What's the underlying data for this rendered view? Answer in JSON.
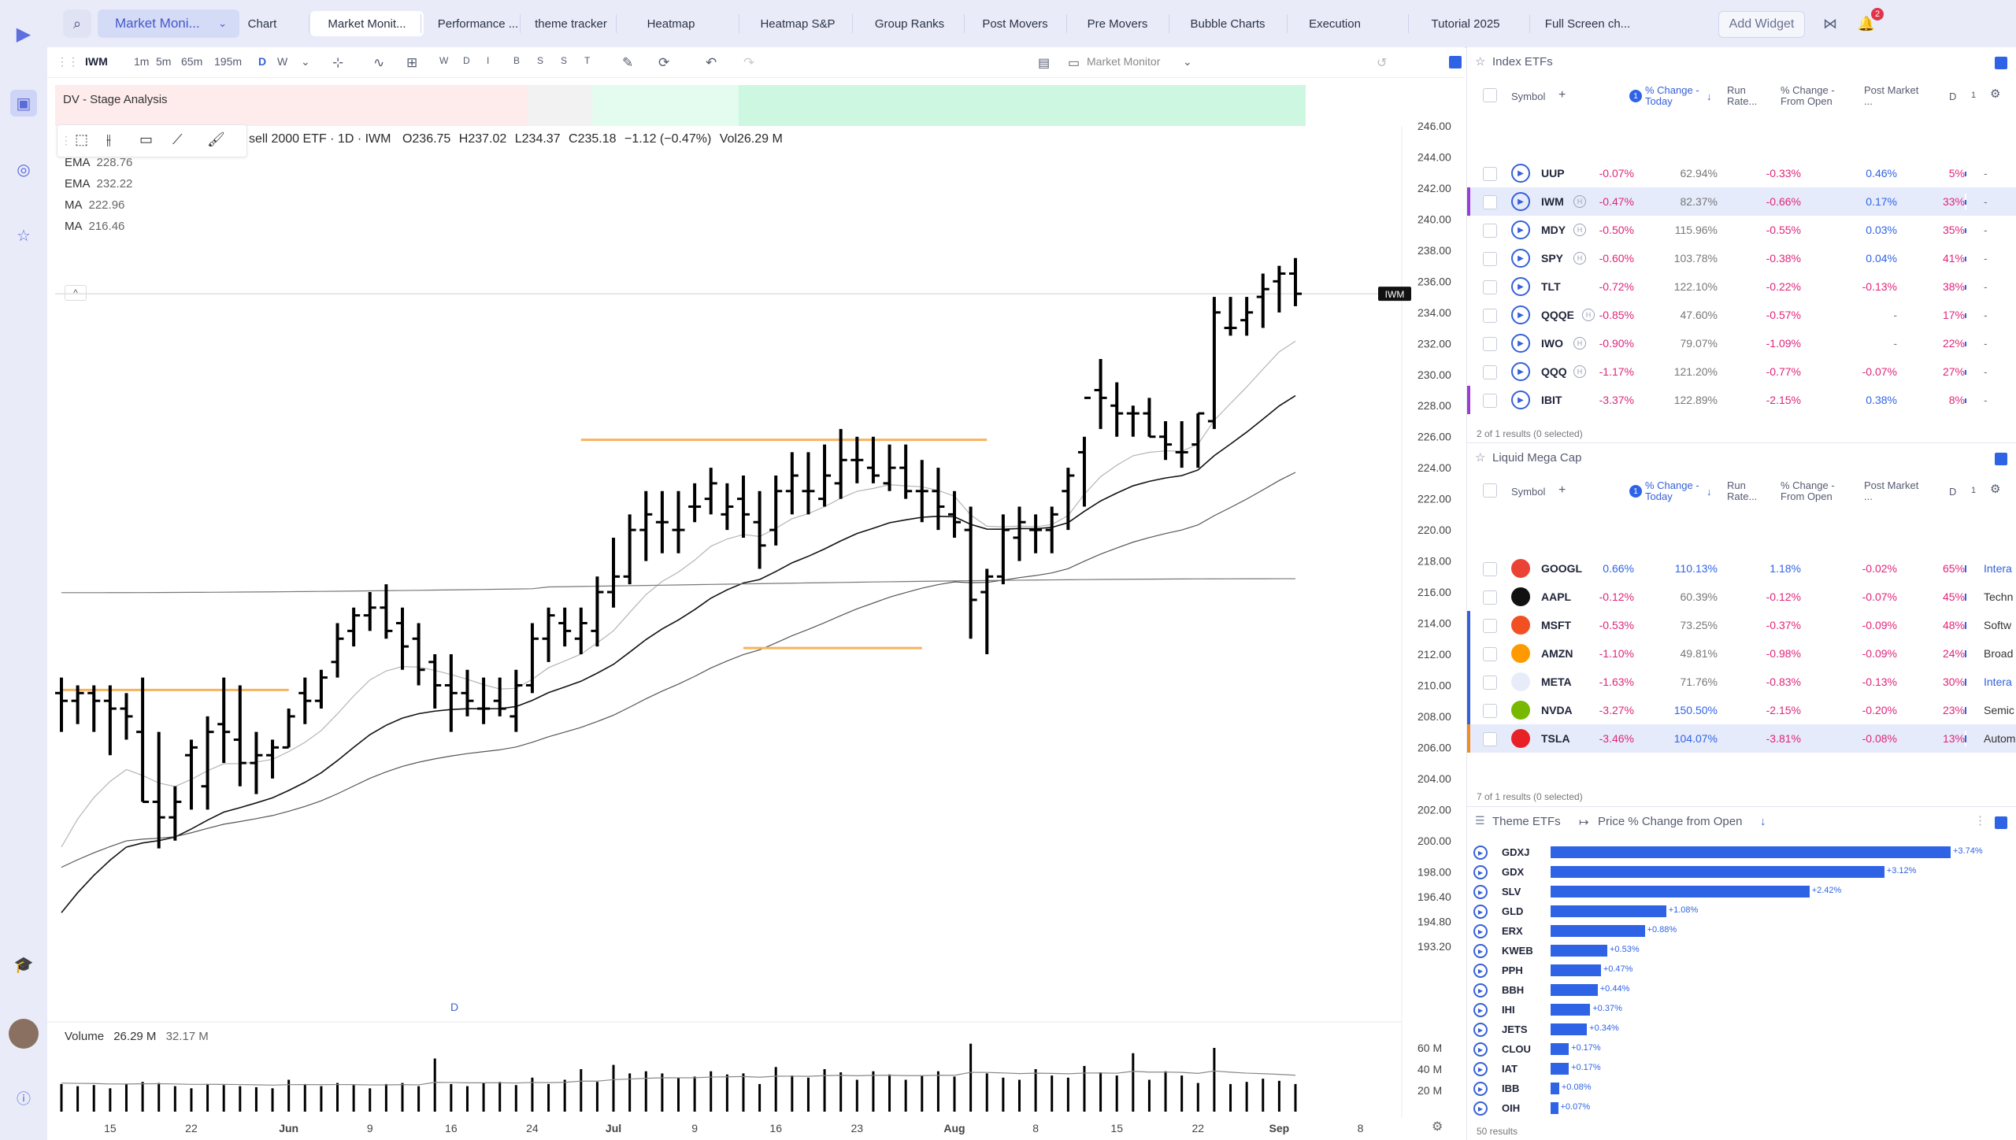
{
  "topbar": {
    "layout_name": "Market Moni...",
    "tabs": [
      "Chart",
      "Market Monit...",
      "Performance ...",
      "theme tracker",
      "Heatmap",
      "Heatmap S&P",
      "Group Ranks",
      "Post Movers",
      "Pre Movers",
      "Bubble Charts",
      "Execution",
      "Tutorial 2025",
      "Full Screen ch..."
    ],
    "active_tab": 1,
    "add_widget": "Add Widget",
    "notifications": "2"
  },
  "chart": {
    "toolbar": {
      "symbol": "IWM",
      "intervals": [
        "1m",
        "5m",
        "65m",
        "195m",
        "D",
        "W"
      ],
      "active_interval": "D",
      "shortcuts": [
        "W",
        "D",
        "I",
        "B",
        "S",
        "S",
        "T"
      ],
      "layout": "Market Monitor"
    },
    "stage_label": "DV - Stage Analysis",
    "legend": {
      "title": "sell 2000 ETF · 1D · IWM",
      "o_label": "O",
      "o": "236.75",
      "h_label": "H",
      "h": "237.02",
      "l_label": "L",
      "l": "234.37",
      "c_label": "C",
      "c": "235.18",
      "change": "−1.12 (−0.47%)",
      "vol_label": "Vol",
      "vol": "26.29 M"
    },
    "indicators": [
      {
        "name": "EMA",
        "value": "228.76"
      },
      {
        "name": "EMA",
        "value": "232.22"
      },
      {
        "name": "MA",
        "value": "222.96"
      },
      {
        "name": "MA",
        "value": "216.46"
      }
    ],
    "price_tag": "IWM",
    "d_marker": "D",
    "volume_title": "Volume",
    "volume_value": "26.29 M",
    "volume_ma": "32.17 M",
    "volume_axis": [
      "60 M",
      "40 M",
      "20 M"
    ],
    "price_axis": [
      "246.00",
      "244.00",
      "242.00",
      "240.00",
      "238.00",
      "236.00",
      "234.00",
      "232.00",
      "230.00",
      "228.00",
      "226.00",
      "224.00",
      "222.00",
      "220.00",
      "218.00",
      "216.00",
      "214.00",
      "212.00",
      "210.00",
      "208.00",
      "206.00",
      "204.00",
      "202.00",
      "200.00",
      "198.00",
      "196.40",
      "194.80",
      "193.20"
    ],
    "date_axis": [
      "15",
      "22",
      "Jun",
      "9",
      "16",
      "24",
      "Jul",
      "9",
      "16",
      "23",
      "Aug",
      "8",
      "15",
      "22",
      "Sep",
      "8"
    ]
  },
  "chart_data": {
    "type": "bar",
    "series_kind": "ohlc",
    "symbol": "IWM",
    "ylim": [
      193.2,
      246
    ],
    "x": [
      "May 12",
      "May 13",
      "May 14",
      "May 15",
      "May 16",
      "May 19",
      "May 20",
      "May 21",
      "May 22",
      "May 23",
      "May 27",
      "May 28",
      "May 29",
      "May 30",
      "Jun 2",
      "Jun 3",
      "Jun 4",
      "Jun 5",
      "Jun 6",
      "Jun 9",
      "Jun 10",
      "Jun 11",
      "Jun 12",
      "Jun 13",
      "Jun 16",
      "Jun 17",
      "Jun 18",
      "Jun 20",
      "Jun 23",
      "Jun 24",
      "Jun 25",
      "Jun 26",
      "Jun 27",
      "Jun 30",
      "Jul 1",
      "Jul 2",
      "Jul 3",
      "Jul 7",
      "Jul 8",
      "Jul 9",
      "Jul 10",
      "Jul 11",
      "Jul 14",
      "Jul 15",
      "Jul 16",
      "Jul 17",
      "Jul 18",
      "Jul 21",
      "Jul 22",
      "Jul 23",
      "Jul 24",
      "Jul 25",
      "Jul 28",
      "Jul 29",
      "Jul 30",
      "Jul 31",
      "Aug 1",
      "Aug 4",
      "Aug 5",
      "Aug 6",
      "Aug 7",
      "Aug 8",
      "Aug 11",
      "Aug 12",
      "Aug 13",
      "Aug 14",
      "Aug 15",
      "Aug 18",
      "Aug 19",
      "Aug 20",
      "Aug 21",
      "Aug 22",
      "Aug 25",
      "Aug 26",
      "Aug 27",
      "Aug 28",
      "Aug 29"
    ],
    "open": [
      209.5,
      209,
      209.5,
      209,
      208.5,
      207,
      202.5,
      201.5,
      205.5,
      203.5,
      207.5,
      206.5,
      205,
      205.5,
      206,
      209.5,
      209,
      211.5,
      213.5,
      214.5,
      215,
      214,
      213,
      211.5,
      210,
      209.5,
      208.5,
      209,
      208,
      210,
      213,
      214,
      213,
      213.5,
      216,
      217,
      220,
      220.5,
      220,
      221.5,
      222,
      221,
      222,
      220.5,
      220,
      222.5,
      222.5,
      222,
      223,
      224.5,
      224,
      223,
      224,
      222.5,
      222.5,
      221,
      220,
      216,
      217,
      219.5,
      220,
      220,
      222.5,
      225,
      229,
      228,
      227.5,
      227.5,
      226,
      225,
      225.5,
      227,
      233,
      233.5,
      235,
      236,
      236.5
    ],
    "high": [
      210.5,
      210,
      210,
      210,
      209.5,
      210.5,
      207,
      203.5,
      206.5,
      208,
      210.5,
      210,
      207,
      206.5,
      208.5,
      210.5,
      211,
      214,
      215,
      216,
      216.5,
      215,
      214,
      212,
      212,
      211,
      210.5,
      210.5,
      211,
      214,
      215,
      215,
      215,
      217,
      219.5,
      221,
      222.5,
      222.5,
      222.5,
      223,
      224,
      223,
      223.5,
      222.5,
      223.5,
      225,
      225,
      225.5,
      226.5,
      226,
      226,
      225.5,
      225.5,
      224.5,
      224,
      222.5,
      221.5,
      217.5,
      221,
      221.5,
      221,
      221.5,
      224,
      226,
      231,
      229.5,
      228,
      228.5,
      227,
      227,
      227.5,
      235,
      235,
      235,
      236.5,
      237,
      237.5
    ],
    "low": [
      207,
      207.5,
      207,
      205.5,
      206.5,
      202.5,
      199.5,
      200,
      202,
      202,
      205,
      203.5,
      203,
      204,
      206,
      207.5,
      208.5,
      210.5,
      212.5,
      213.5,
      213,
      211,
      210,
      208.5,
      207,
      208,
      207.5,
      208,
      207,
      209.5,
      211.5,
      212.5,
      212,
      212.5,
      215,
      216.5,
      218,
      218.5,
      218.5,
      220.5,
      221,
      220,
      219.5,
      217.5,
      219,
      221,
      221,
      221.5,
      222,
      223,
      223,
      222.5,
      222,
      220.5,
      220,
      219.5,
      213,
      212,
      216.5,
      218,
      218.5,
      218.5,
      220,
      221.5,
      226.5,
      226,
      226,
      226,
      224.5,
      224,
      224,
      226.5,
      232.5,
      232.5,
      233,
      234,
      234.4
    ],
    "close": [
      209,
      209.5,
      209,
      208.5,
      208,
      202.5,
      201.5,
      202.5,
      206,
      207,
      207,
      205,
      205.5,
      206,
      208,
      209,
      210.5,
      213,
      214.5,
      215,
      213.5,
      212.5,
      211,
      210,
      209.5,
      209,
      208.5,
      208.5,
      210,
      213,
      214.5,
      213.5,
      214,
      216,
      217,
      220,
      221,
      220.5,
      220,
      221.5,
      223,
      221.5,
      221,
      219,
      222.5,
      223.5,
      222.5,
      223.5,
      224.5,
      224.5,
      223.5,
      224,
      222.5,
      222.5,
      221.5,
      220.5,
      215.5,
      217,
      220,
      220.5,
      220,
      221,
      223.5,
      228.5,
      228.5,
      227.5,
      227.5,
      226,
      225.5,
      225,
      227.5,
      234,
      233,
      234,
      235.5,
      236.5,
      235.2
    ],
    "volume_millions": [
      26,
      24,
      25,
      22,
      26,
      28,
      27,
      24,
      22,
      26,
      25,
      24,
      23,
      22,
      30,
      26,
      24,
      27,
      25,
      22,
      26,
      27,
      24,
      50,
      26,
      24,
      27,
      28,
      25,
      32,
      26,
      30,
      40,
      28,
      44,
      36,
      38,
      36,
      32,
      33,
      38,
      35,
      36,
      26,
      42,
      34,
      32,
      40,
      37,
      30,
      38,
      35,
      30,
      34,
      38,
      33,
      64,
      36,
      32,
      30,
      40,
      34,
      32,
      43,
      37,
      34,
      55,
      30,
      38,
      34,
      27,
      60,
      26,
      28,
      31,
      29,
      26
    ],
    "levels": [
      {
        "type": "horizontal",
        "value": 225.8,
        "color": "#f6b35d"
      },
      {
        "type": "horizontal",
        "value": 212.4,
        "color": "#f6b35d"
      },
      {
        "type": "horizontal",
        "value": 209.7,
        "color": "#f6b35d"
      }
    ],
    "moving_averages": [
      {
        "name": "EMA",
        "last": "232.22"
      },
      {
        "name": "EMA",
        "last": "228.76"
      },
      {
        "name": "MA",
        "last": "222.96"
      },
      {
        "name": "MA",
        "last": "216.46"
      }
    ]
  },
  "index_etfs": {
    "title": "Index ETFs",
    "columns": [
      "Symbol",
      "% Change - Today",
      "Run Rate...",
      "% Change - From Open",
      "Post Market ...",
      "D",
      "1"
    ],
    "sort_badge": "1",
    "rows": [
      {
        "symbol": "UUP",
        "today": "-0.07%",
        "run": "62.94%",
        "open": "-0.33%",
        "post": "0.46%",
        "d": "5%",
        "h": false,
        "edge": ""
      },
      {
        "symbol": "IWM",
        "today": "-0.47%",
        "run": "82.37%",
        "open": "-0.66%",
        "post": "0.17%",
        "d": "33%",
        "h": true,
        "edge": "#9a3cd8",
        "selected": true
      },
      {
        "symbol": "MDY",
        "today": "-0.50%",
        "run": "115.96%",
        "open": "-0.55%",
        "post": "0.03%",
        "d": "35%",
        "h": true,
        "edge": ""
      },
      {
        "symbol": "SPY",
        "today": "-0.60%",
        "run": "103.78%",
        "open": "-0.38%",
        "post": "0.04%",
        "d": "41%",
        "h": true,
        "edge": ""
      },
      {
        "symbol": "TLT",
        "today": "-0.72%",
        "run": "122.10%",
        "open": "-0.22%",
        "post": "-0.13%",
        "d": "38%",
        "h": false,
        "edge": ""
      },
      {
        "symbol": "QQQE",
        "today": "-0.85%",
        "run": "47.60%",
        "open": "-0.57%",
        "post": "-",
        "d": "17%",
        "h": true,
        "edge": ""
      },
      {
        "symbol": "IWO",
        "today": "-0.90%",
        "run": "79.07%",
        "open": "-1.09%",
        "post": "-",
        "d": "22%",
        "h": true,
        "edge": ""
      },
      {
        "symbol": "QQQ",
        "today": "-1.17%",
        "run": "121.20%",
        "open": "-0.77%",
        "post": "-0.07%",
        "d": "27%",
        "h": true,
        "edge": ""
      },
      {
        "symbol": "IBIT",
        "today": "-3.37%",
        "run": "122.89%",
        "open": "-2.15%",
        "post": "0.38%",
        "d": "8%",
        "h": false,
        "edge": "#9a3cd8"
      }
    ],
    "results": "2 of 1 results (0 selected)"
  },
  "mega_cap": {
    "title": "Liquid Mega Cap",
    "columns": [
      "Symbol",
      "% Change - Today",
      "Run Rate...",
      "% Change - From Open",
      "Post Market ...",
      "D",
      "1"
    ],
    "sort_badge": "1",
    "rows": [
      {
        "symbol": "GOOGL",
        "today": "0.66%",
        "run": "110.13%",
        "open": "1.18%",
        "post": "-0.02%",
        "d": "65%",
        "sector": "Intera",
        "sector_link": true,
        "logo": "#ea4335",
        "edge": ""
      },
      {
        "symbol": "AAPL",
        "today": "-0.12%",
        "run": "60.39%",
        "open": "-0.12%",
        "post": "-0.07%",
        "d": "45%",
        "sector": "Techn",
        "sector_link": false,
        "logo": "#111111",
        "edge": ""
      },
      {
        "symbol": "MSFT",
        "today": "-0.53%",
        "run": "73.25%",
        "open": "-0.37%",
        "post": "-0.09%",
        "d": "48%",
        "sector": "Softw",
        "sector_link": false,
        "logo": "#f25022",
        "edge": "#3560d8"
      },
      {
        "symbol": "AMZN",
        "today": "-1.10%",
        "run": "49.81%",
        "open": "-0.98%",
        "post": "-0.09%",
        "d": "24%",
        "sector": "Broad",
        "sector_link": false,
        "logo": "#ff9900",
        "edge": "#3560d8"
      },
      {
        "symbol": "META",
        "today": "-1.63%",
        "run": "71.76%",
        "open": "-0.83%",
        "post": "-0.13%",
        "d": "30%",
        "sector": "Intera",
        "sector_link": true,
        "logo": "#e8ecf8",
        "edge": "#3560d8"
      },
      {
        "symbol": "NVDA",
        "today": "-3.27%",
        "run": "150.50%",
        "open": "-2.15%",
        "post": "-0.20%",
        "d": "23%",
        "sector": "Semic",
        "sector_link": false,
        "logo": "#76b900",
        "edge": "#3560d8"
      },
      {
        "symbol": "TSLA",
        "today": "-3.46%",
        "run": "104.07%",
        "open": "-3.81%",
        "post": "-0.08%",
        "d": "13%",
        "sector": "Autom",
        "sector_link": false,
        "logo": "#e82127",
        "edge": "#f08a24",
        "selected": true
      }
    ],
    "results": "7 of 1 results (0 selected)"
  },
  "theme_etfs": {
    "title": "Theme ETFs",
    "metric": "Price % Change from Open",
    "rows": [
      {
        "symbol": "GDXJ",
        "value": 3.74,
        "label": "+3.74%"
      },
      {
        "symbol": "GDX",
        "value": 3.12,
        "label": "+3.12%"
      },
      {
        "symbol": "SLV",
        "value": 2.42,
        "label": "+2.42%"
      },
      {
        "symbol": "GLD",
        "value": 1.08,
        "label": "+1.08%"
      },
      {
        "symbol": "ERX",
        "value": 0.88,
        "label": "+0.88%"
      },
      {
        "symbol": "KWEB",
        "value": 0.53,
        "label": "+0.53%"
      },
      {
        "symbol": "PPH",
        "value": 0.47,
        "label": "+0.47%"
      },
      {
        "symbol": "BBH",
        "value": 0.44,
        "label": "+0.44%"
      },
      {
        "symbol": "IHI",
        "value": 0.37,
        "label": "+0.37%"
      },
      {
        "symbol": "JETS",
        "value": 0.34,
        "label": "+0.34%"
      },
      {
        "symbol": "CLOU",
        "value": 0.17,
        "label": "+0.17%"
      },
      {
        "symbol": "IAT",
        "value": 0.17,
        "label": "+0.17%"
      },
      {
        "symbol": "IBB",
        "value": 0.08,
        "label": "+0.08%"
      },
      {
        "symbol": "OIH",
        "value": 0.07,
        "label": "+0.07%"
      }
    ],
    "results": "50 results"
  }
}
